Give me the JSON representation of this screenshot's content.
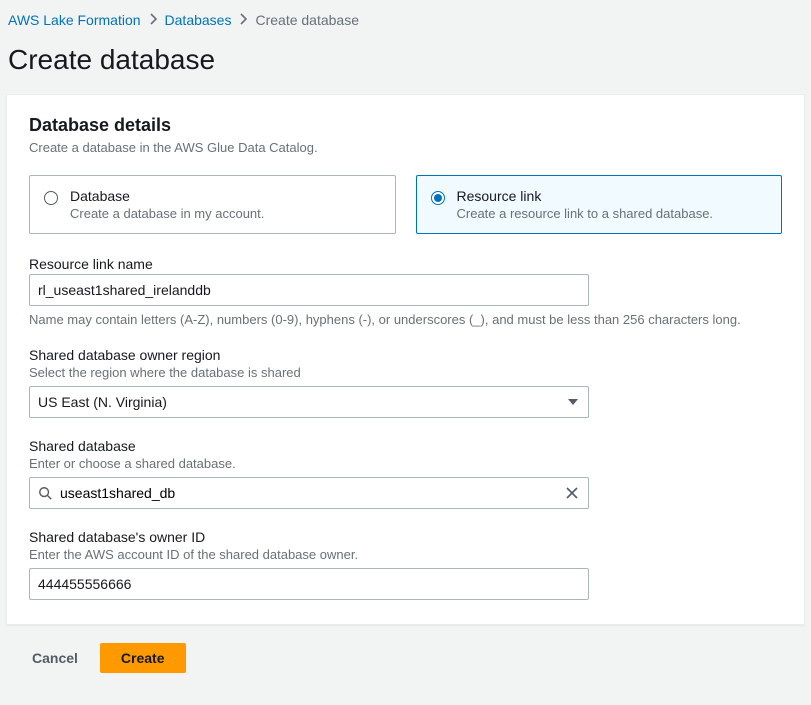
{
  "breadcrumb": {
    "root": "AWS Lake Formation",
    "mid": "Databases",
    "current": "Create database"
  },
  "page_title": "Create database",
  "panel": {
    "title": "Database details",
    "subtitle": "Create a database in the AWS Glue Data Catalog."
  },
  "options": {
    "database": {
      "label": "Database",
      "desc": "Create a database in my account."
    },
    "resource_link": {
      "label": "Resource link",
      "desc": "Create a resource link to a shared database."
    }
  },
  "fields": {
    "link_name": {
      "label": "Resource link name",
      "value": "rl_useast1shared_irelanddb",
      "hint": "Name may contain letters (A-Z), numbers (0-9), hyphens (-), or underscores (_), and must be less than 256 characters long."
    },
    "owner_region": {
      "label": "Shared database owner region",
      "hint": "Select the region where the database is shared",
      "value": "US East (N. Virginia)"
    },
    "shared_db": {
      "label": "Shared database",
      "hint": "Enter or choose a shared database.",
      "value": "useast1shared_db"
    },
    "owner_id": {
      "label": "Shared database's owner ID",
      "hint": "Enter the AWS account ID of the shared database owner.",
      "value": "444455556666"
    }
  },
  "actions": {
    "cancel": "Cancel",
    "create": "Create"
  }
}
